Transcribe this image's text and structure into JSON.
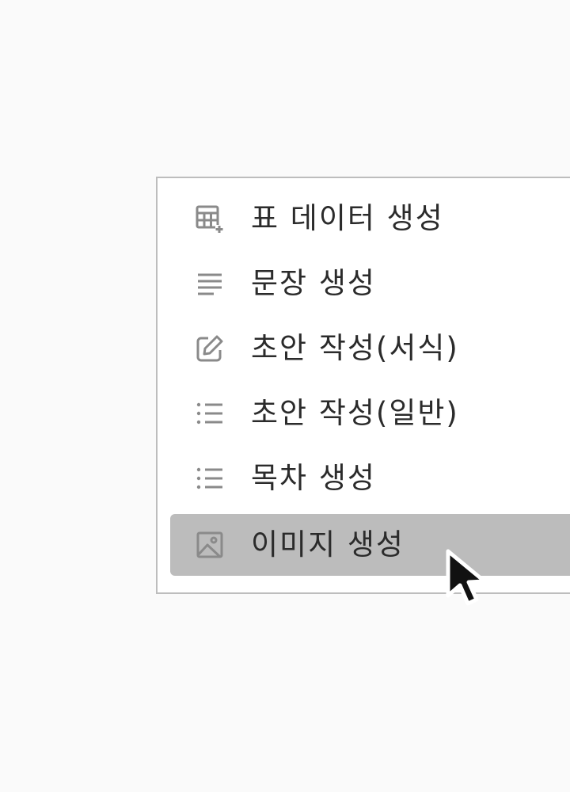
{
  "menu": {
    "items": [
      {
        "label": "표 데이터 생성",
        "icon": "table-plus-icon"
      },
      {
        "label": "문장 생성",
        "icon": "text-lines-icon"
      },
      {
        "label": "초안 작성(서식)",
        "icon": "edit-icon"
      },
      {
        "label": "초안 작성(일반)",
        "icon": "bullet-list-icon"
      },
      {
        "label": "목차 생성",
        "icon": "bullet-list-icon"
      },
      {
        "label": "이미지 생성",
        "icon": "image-icon"
      }
    ],
    "active_item_label": "이미지 생성"
  },
  "colors": {
    "background": "#fafafa",
    "menu_background": "#ffffff",
    "menu_border": "#bdbdbd",
    "active_background": "#bcbcbc",
    "text": "#2b2b2b",
    "icon": "#8a8a8a"
  }
}
